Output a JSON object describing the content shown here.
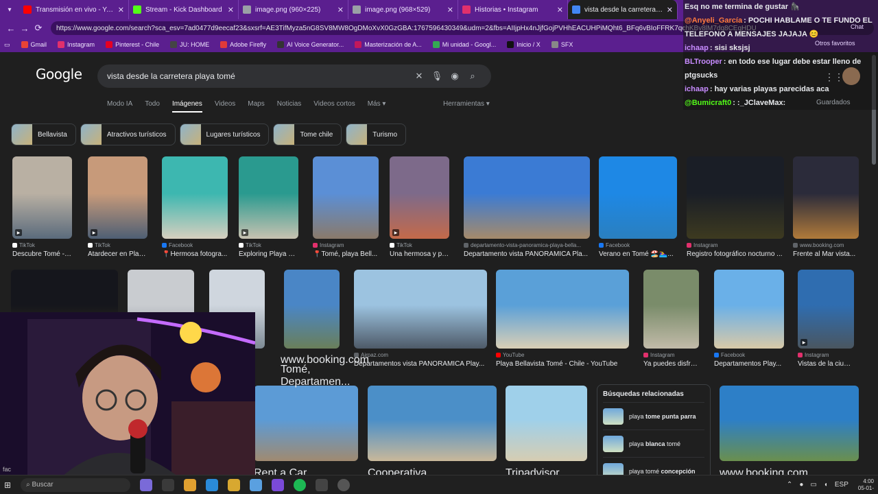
{
  "tabs": [
    {
      "label": "Transmisión en vivo - YouTube St",
      "color": "#ff0000"
    },
    {
      "label": "Stream - Kick Dashboard",
      "color": "#53fc18"
    },
    {
      "label": "image.png (960×225)",
      "color": "#9aa0a6"
    },
    {
      "label": "image.png (968×529)",
      "color": "#9aa0a6"
    },
    {
      "label": "Historias • Instagram",
      "color": "#e1306c"
    },
    {
      "label": "vista desde la carretera playa tomé",
      "color": "#4285f4"
    }
  ],
  "url": "https://www.google.com/search?sca_esv=7ad0477d9eecaf23&sxsrf=AE3TifMyza5nG8SV8MW8OgDMoXvX0GzGBA:1767596430349&udm=2&fbs=AIIjpHx4nJjfGojPVHhEACUHPiMQht6_BFq6vBIoFFRK7qchKBv8lM7dq8CEqHDU",
  "bookmarks": [
    "Gmail",
    "Instagram",
    "Pinterest - Chile",
    "JU: HOME",
    "Adobe Firefly",
    "AI Voice Generator...",
    "Masterización de A...",
    "Mi unidad - Googl...",
    "Inicio / X",
    "SFX"
  ],
  "bookmark_overflow": "Otros favoritos",
  "google": {
    "logo": "Google",
    "query": "vista desde la carretera playa tomé",
    "nav": [
      "Modo IA",
      "Todo",
      "Imágenes",
      "Videos",
      "Maps",
      "Noticias",
      "Videos cortos",
      "Más ▾"
    ],
    "selected_nav": "Imágenes",
    "tools": "Herramientas ▾",
    "saved": "Guardados",
    "chips": [
      "Bellavista",
      "Atractivos turísticos",
      "Lugares turísticos",
      "Tome chile",
      "Turismo"
    ]
  },
  "row1": [
    {
      "source": "TikTok",
      "title": "Descubre Tomé - ...",
      "video": true,
      "c1": "#b9b0a3",
      "c2": "#5b6b7c"
    },
    {
      "source": "TikTok",
      "title": "Atardecer en Playa...",
      "video": true,
      "c1": "#c79a7a",
      "c2": "#4e5f74"
    },
    {
      "source": "Facebook",
      "title": "📍Hermosa fotogra...",
      "video": false,
      "c1": "#3db7b0",
      "c2": "#d7cfbf"
    },
    {
      "source": "TikTok",
      "title": "Exploring Playa Be...",
      "video": true,
      "c1": "#2a9a8f",
      "c2": "#c8c2b1"
    },
    {
      "source": "Instagram",
      "title": "📍Tomé, playa Bell...",
      "video": false,
      "c1": "#5b8fd6",
      "c2": "#8a7a6a"
    },
    {
      "source": "TikTok",
      "title": "Una hermosa y po...",
      "video": true,
      "c1": "#7d6a8a",
      "c2": "#c46a4a"
    },
    {
      "source": "departamento-vista-panoramica-playa-bella...",
      "title": "Departamento vista PANORAMICA Pla...",
      "video": false,
      "c1": "#3b7bd4",
      "c2": "#a58a6a"
    },
    {
      "source": "Facebook",
      "title": "Verano en Tomé 🏖️🏊‍♀️...",
      "video": false,
      "c1": "#1e88e5",
      "c2": "#2a7fbf"
    },
    {
      "source": "Instagram",
      "title": "Registro fotográfico nocturno ...",
      "video": false,
      "c1": "#1a1e26",
      "c2": "#3d3a20"
    },
    {
      "source": "www.booking.com",
      "title": "Frente al Mar vista...",
      "video": false,
      "c1": "#2b2b3a",
      "c2": "#b07a3a"
    }
  ],
  "row2": [
    {
      "source": "",
      "title": "",
      "video": false,
      "c1": "#15161c",
      "c2": "#3a3520"
    },
    {
      "source": "",
      "title": "",
      "video": false,
      "c1": "#c9ccd0",
      "c2": "#8a9098"
    },
    {
      "source": "",
      "title": "",
      "video": false,
      "c1": "#cfd6de",
      "c2": "#7d8a94"
    },
    {
      "source": "",
      "title": "",
      "video": false,
      "c1": "#4a86c6",
      "c2": "#6a7f5a"
    },
    {
      "source": "Airpaz.com",
      "title": "Departamentos vista PANORAMICA Play...",
      "video": false,
      "c1": "#9cc3e0",
      "c2": "#4e5a68"
    },
    {
      "source": "YouTube",
      "title": "Playa Bellavista Tomé - Chile - YouTube",
      "video": false,
      "c1": "#5aa0d8",
      "c2": "#d9cfb6"
    },
    {
      "source": "Instagram",
      "title": "Ya puedes disfruta...",
      "video": false,
      "c1": "#7a8c6a",
      "c2": "#c2bba9"
    },
    {
      "source": "Facebook",
      "title": "Departamentos Play...",
      "video": false,
      "c1": "#6ab0e8",
      "c2": "#d8c9a8"
    },
    {
      "source": "Instagram",
      "title": "Vistas de la ciudad...",
      "video": true,
      "c1": "#2f6db0",
      "c2": "#4a5660"
    }
  ],
  "row2_hidden": {
    "source": "www.booking.com",
    "title": "Tomé, Departamen..."
  },
  "row3": [
    {
      "source": "Rent a Car",
      "title": "",
      "c1": "#5c9bd6",
      "c2": "#a08a70"
    },
    {
      "source": "Cooperativa",
      "title": "",
      "c1": "#4b8fc8",
      "c2": "#c9b89a"
    },
    {
      "source": "Tripadvisor",
      "title": "",
      "c1": "#9fd0ea",
      "c2": "#d6cdb2"
    },
    {
      "source": "www.booking.com",
      "title": "",
      "c1": "#2d7fc7",
      "c2": "#6a8f4e"
    }
  ],
  "related": {
    "heading": "Búsquedas relacionadas",
    "items": [
      {
        "pre": "playa ",
        "bold": "tome punta parra",
        "post": ""
      },
      {
        "pre": "playa ",
        "bold": "blanca",
        "post": " tomé"
      },
      {
        "pre": "playa tomé ",
        "bold": "concepción",
        "post": ""
      }
    ]
  },
  "chat": [
    {
      "name": "",
      "name_color": "#ffffff",
      "text": "Esq no me termina de gustar 🦍"
    },
    {
      "name": "@Anyeli_García",
      "name_color": "#ff7a3d",
      "text": ": POCHI HABLAME O TE FUNDO EL TELEFONO A MENSAJES JAJAJA 😊"
    },
    {
      "name": "ichaap",
      "name_color": "#c78bff",
      "text": ": sisi sksjsj"
    },
    {
      "name": "BLTrooper",
      "name_color": "#c78bff",
      "text": ": en todo ese lugar debe estar lleno de ptgsucks"
    },
    {
      "name": "ichaap",
      "name_color": "#c78bff",
      "text": ": hay varias playas parecidas aca"
    },
    {
      "name": "@Bumicraft0",
      "name_color": "#53fc18",
      "text": ": :_JClaveMax:"
    }
  ],
  "chat_side": {
    "label": "Chat"
  },
  "taskbar": {
    "search": "Buscar",
    "lang": "ESP",
    "time": "4:00",
    "date": "05-01-"
  },
  "webcam_overlay": "fac"
}
